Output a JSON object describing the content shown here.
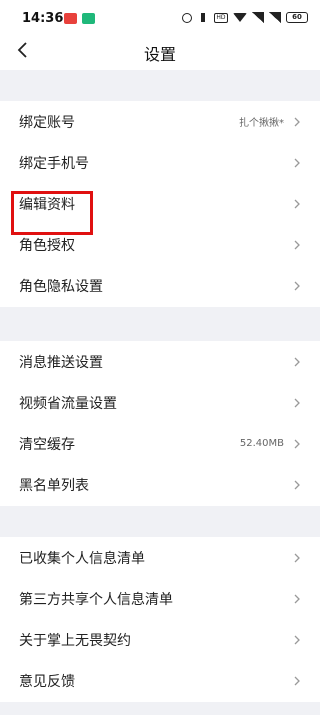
{
  "status_bar": {
    "time": "14:36",
    "battery": "60",
    "icons": [
      "app-red-icon",
      "app-green-icon",
      "alarm-icon",
      "vibrate-icon",
      "hd-icon",
      "wifi-icon",
      "signal-icon",
      "battery-icon"
    ]
  },
  "nav": {
    "title": "设置",
    "back_icon": "chevron-left-icon"
  },
  "groups": [
    {
      "items": [
        {
          "label": "绑定账号",
          "value": "扎个揪揪*"
        },
        {
          "label": "绑定手机号",
          "value": ""
        },
        {
          "label": "编辑资料",
          "value": ""
        },
        {
          "label": "角色授权",
          "value": ""
        },
        {
          "label": "角色隐私设置",
          "value": ""
        }
      ]
    },
    {
      "items": [
        {
          "label": "消息推送设置",
          "value": ""
        },
        {
          "label": "视频省流量设置",
          "value": ""
        },
        {
          "label": "清空缓存",
          "value": "52.40MB"
        },
        {
          "label": "黑名单列表",
          "value": ""
        }
      ]
    },
    {
      "items": [
        {
          "label": "已收集个人信息清单",
          "value": ""
        },
        {
          "label": "第三方共享个人信息清单",
          "value": ""
        },
        {
          "label": "关于掌上无畏契约",
          "value": ""
        },
        {
          "label": "意见反馈",
          "value": ""
        }
      ]
    }
  ],
  "colors": {
    "page_background": "#f0f1f5",
    "highlight_box": "#e01010",
    "chevron": "#9a9a9a"
  }
}
